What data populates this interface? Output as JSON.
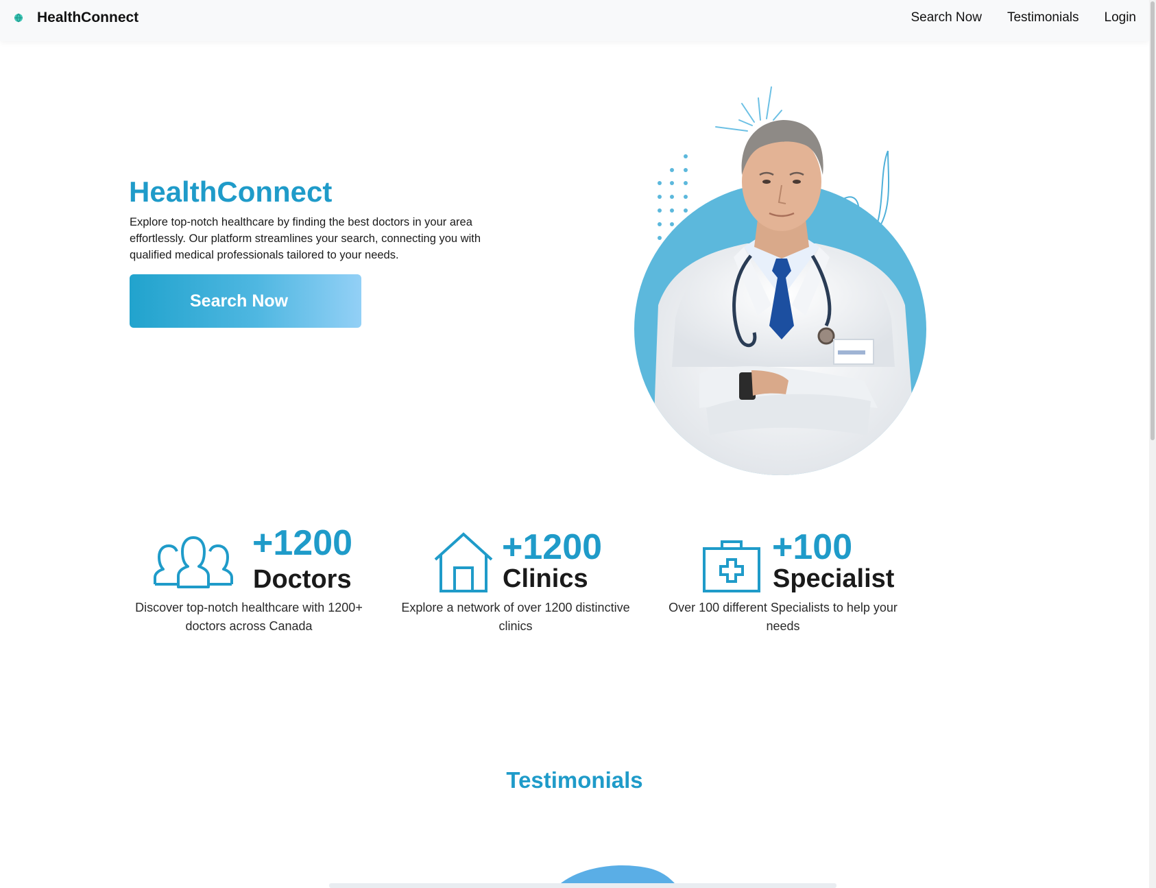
{
  "navbar": {
    "brand": "HealthConnect",
    "links": [
      "Search Now",
      "Testimonials",
      "Login"
    ]
  },
  "hero": {
    "title": "HealthConnect",
    "description": "Explore top-notch healthcare by finding the best doctors in your area effortlessly. Our platform streamlines your search, connecting you with qualified medical professionals tailored to your needs.",
    "button_label": "Search Now"
  },
  "stats": [
    {
      "icon": "people-icon",
      "number": "+1200",
      "label": "Doctors",
      "description": "Discover top-notch healthcare with 1200+ doctors across Canada"
    },
    {
      "icon": "house-icon",
      "number": "+1200",
      "label": "Clinics",
      "description": "Explore a network of over 1200 distinctive clinics"
    },
    {
      "icon": "medical-kit-icon",
      "number": "+100",
      "label": "Specialist",
      "description": "Over 100 different Specialists to help your needs"
    }
  ],
  "testimonials": {
    "title": "Testimonials"
  },
  "colors": {
    "accent": "#1f9bc9",
    "button_gradient_start": "#21a3cd",
    "button_gradient_end": "#93d0f6",
    "navbar_bg": "#f8f9fa",
    "hero_circle": "#5cb8dc"
  }
}
